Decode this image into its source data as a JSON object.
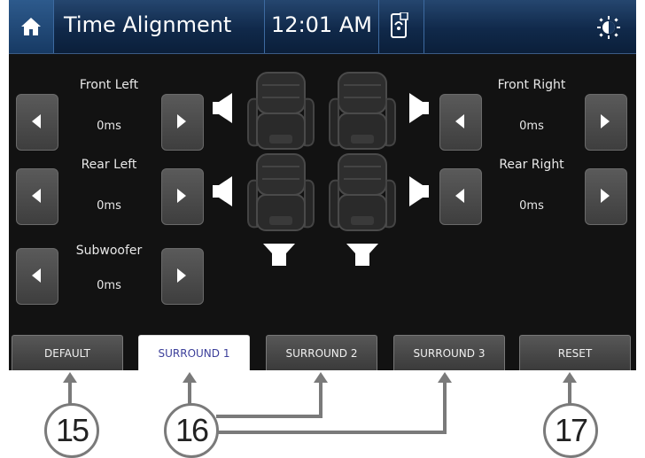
{
  "header": {
    "title": "Time Alignment",
    "time": "12:01 AM",
    "icons": [
      "home-icon",
      "phone-link-icon",
      "brightness-icon"
    ]
  },
  "channels": [
    {
      "name": "Front Left",
      "value": "0ms"
    },
    {
      "name": "Rear Left",
      "value": "0ms"
    },
    {
      "name": "Subwoofer",
      "value": "0ms"
    },
    {
      "name": "Front Right",
      "value": "0ms"
    },
    {
      "name": "Rear Right",
      "value": "0ms"
    }
  ],
  "presets": [
    {
      "label": "DEFAULT",
      "active": false
    },
    {
      "label": "SURROUND 1",
      "active": true
    },
    {
      "label": "SURROUND 2",
      "active": false
    },
    {
      "label": "SURROUND 3",
      "active": false
    },
    {
      "label": "RESET",
      "active": false
    }
  ],
  "callouts": [
    "15",
    "16",
    "17"
  ],
  "colors": {
    "header": "#17355c",
    "screen_bg": "#121212",
    "active_preset_text": "#3c3f9a",
    "callout_line": "#7a7a7a"
  }
}
